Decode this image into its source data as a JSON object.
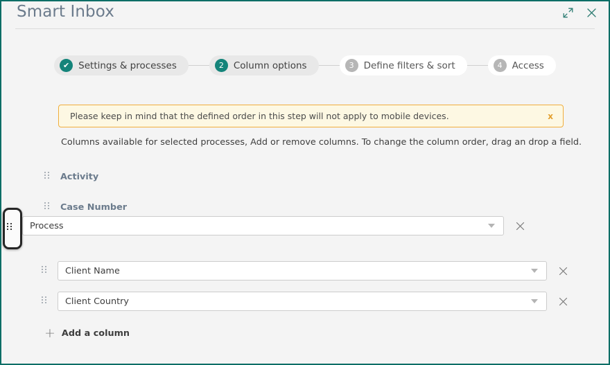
{
  "window": {
    "title": "Smart Inbox",
    "expand_icon": "expand-icon",
    "close_icon": "close-icon",
    "border_color": "#0d6e66",
    "accent_color": "#14847a"
  },
  "stepper": {
    "steps": [
      {
        "badge": "✔",
        "label": "Settings & processes",
        "state": "done"
      },
      {
        "badge": "2",
        "label": "Column options",
        "state": "active"
      },
      {
        "badge": "3",
        "label": "Define filters & sort",
        "state": "todo"
      },
      {
        "badge": "4",
        "label": "Access",
        "state": "todo"
      }
    ]
  },
  "warning": {
    "text": "Please keep in mind that the defined order in this step will not apply to mobile devices.",
    "close_label": "x",
    "background": "#fdf8e3",
    "border_color": "#f0ad3c"
  },
  "description": "Columns available for selected processes, Add or remove columns. To change the column order, drag an drop a field.",
  "columns": {
    "static_rows": [
      {
        "label": "Activity"
      },
      {
        "label": "Case Number"
      }
    ],
    "select_rows": [
      {
        "value": "Process",
        "dragging": true,
        "remove_label": "×"
      },
      {
        "value": "Client Name",
        "dragging": false,
        "remove_label": "×"
      },
      {
        "value": "Client Country",
        "dragging": false,
        "remove_label": "×"
      }
    ]
  },
  "add_column": {
    "plus": "+",
    "label": "Add a column"
  }
}
